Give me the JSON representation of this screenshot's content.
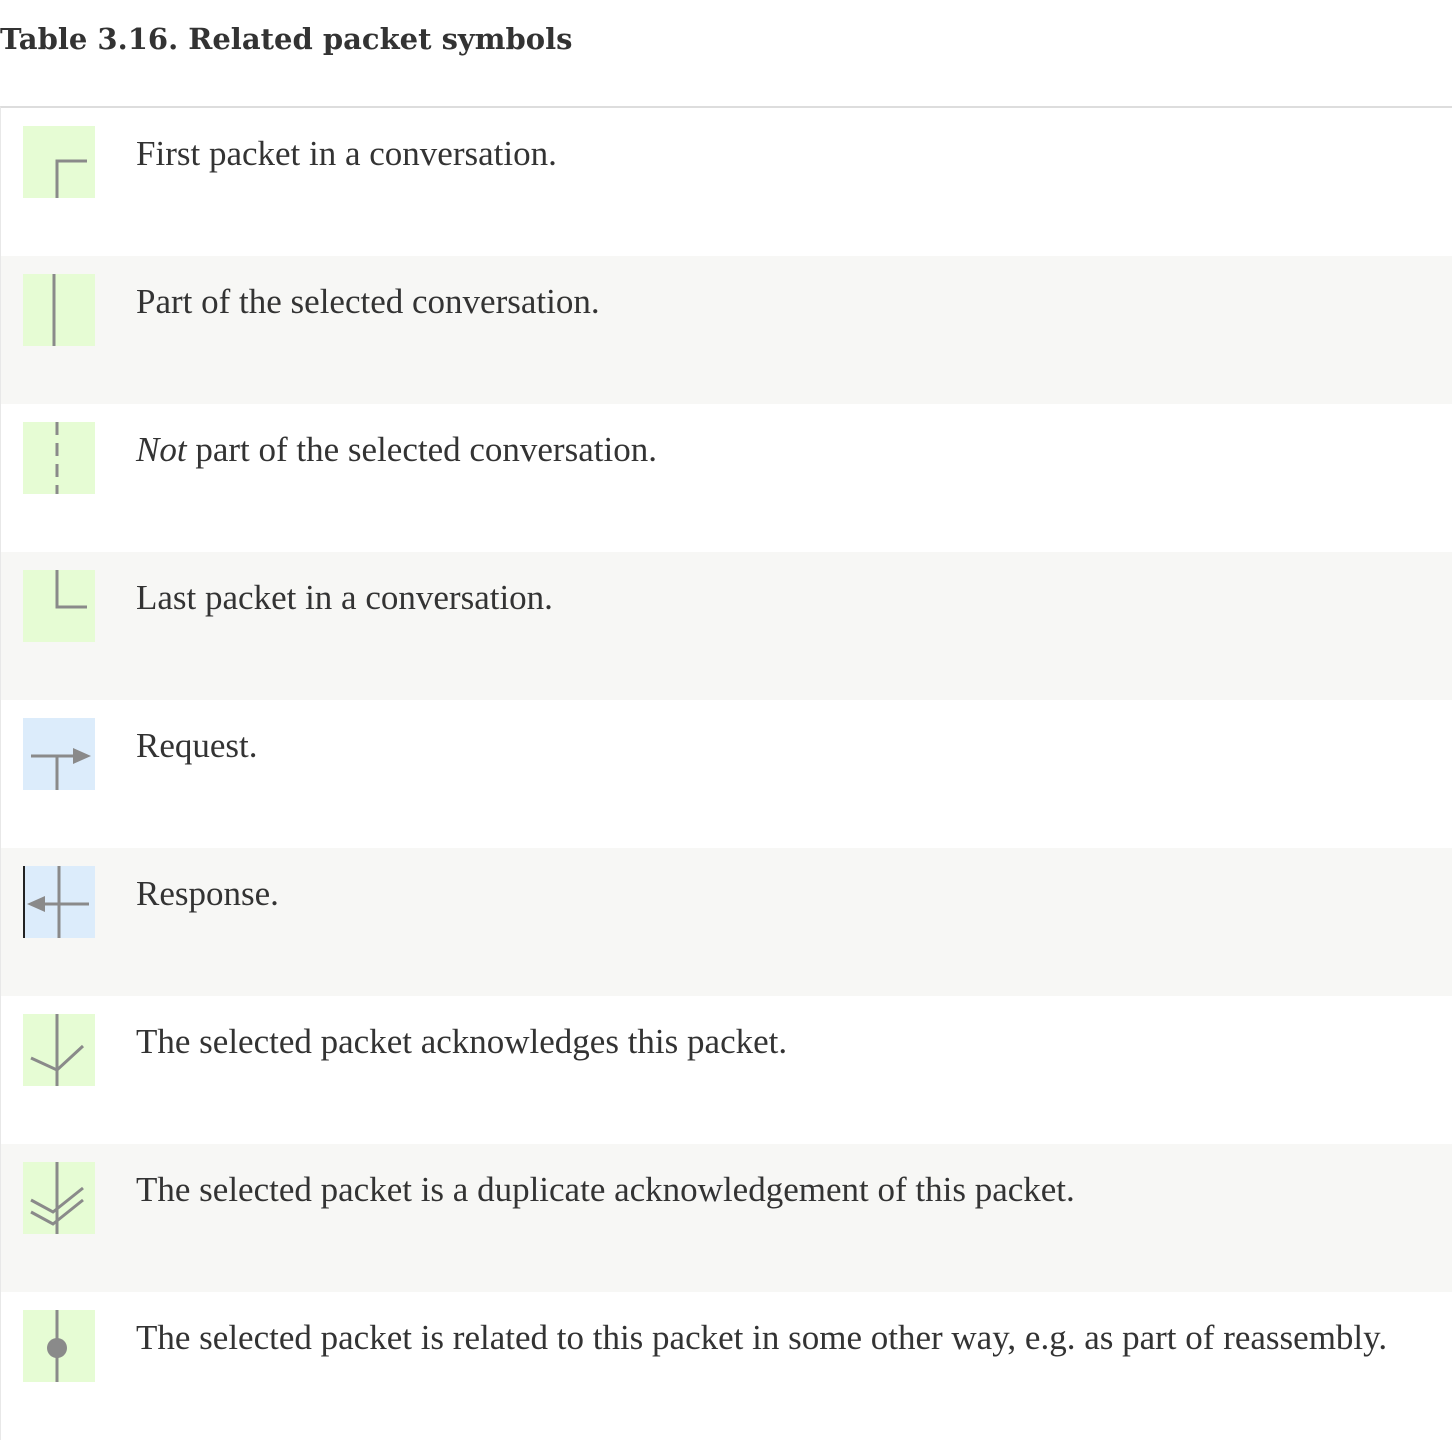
{
  "caption": "Table 3.16. Related packet symbols",
  "colors": {
    "conversation_bg": "#e6fcd4",
    "request_bg": "#dcecfb",
    "symbol_stroke": "#8a8a8a",
    "caret": "#222222"
  },
  "rows": [
    {
      "icon": "first-packet-icon",
      "text": "First packet in a conversation."
    },
    {
      "icon": "part-of-conversation-icon",
      "text": "Part of the selected conversation."
    },
    {
      "icon": "not-part-of-conversation-icon",
      "emph": "Not",
      "text": " part of the selected conversation."
    },
    {
      "icon": "last-packet-icon",
      "text": "Last packet in a conversation."
    },
    {
      "icon": "request-icon",
      "text": "Request."
    },
    {
      "icon": "response-icon",
      "text": "Response."
    },
    {
      "icon": "ack-icon",
      "text": "The selected packet acknowledges this packet."
    },
    {
      "icon": "duplicate-ack-icon",
      "text": "The selected packet is a duplicate acknowledgement of this packet."
    },
    {
      "icon": "related-icon",
      "text": "The selected packet is related to this packet in some other way, e.g. as part of reassembly."
    }
  ]
}
